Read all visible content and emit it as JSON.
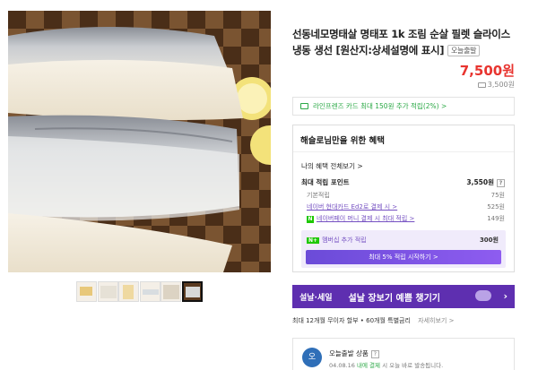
{
  "product": {
    "title": "선동네모명태살 명태포 1k 조림 순살 필렛 슬라이스 냉동 생선 [원산지:상세설명에 표시]",
    "badge": "오늘출발",
    "price": "7,500원",
    "shipping": "3,500원"
  },
  "thumbnails": [
    {
      "selected": false
    },
    {
      "selected": false
    },
    {
      "selected": false
    },
    {
      "selected": false
    },
    {
      "selected": false
    },
    {
      "selected": true
    }
  ],
  "card_promo": "라인프렌즈 카드 최대 150원 추가 적립(2%) >",
  "benefit": {
    "heading": "해슬로님만을 위한 혜택",
    "my_benefit_link": "나의 혜택 전체보기 >",
    "max_points_label": "최대 적립 포인트",
    "max_points_value": "3,550원",
    "rows": [
      {
        "label": "기본적립",
        "value": "75원"
      },
      {
        "label": "네이버 현대카드 Ed2로 결제 시 >",
        "value": "525원"
      },
      {
        "label": "네이버페이 머니 결제 시 최대 적립 >",
        "value": "149원"
      }
    ],
    "membership_label": "멤버십 추가 적립",
    "membership_value": "300원",
    "membership_button": "최대 5% 적립 시작하기 >"
  },
  "banner": {
    "left": "설날·세일",
    "text": "설날 장보기 예쁨 챙기기",
    "arrow": "›"
  },
  "installment": {
    "text": "최대 12개월 무이자 할부 • 60개월 특별금리",
    "more": "자세히보기 >"
  },
  "seller": {
    "logo_text": "오",
    "name": "오늘출발 상품",
    "date_prefix": "04.08.16",
    "date_highlight": "내에 결제",
    "date_suffix": "시 오늘 바로 발송됩니다."
  },
  "colors": {
    "price_red": "#e8342f",
    "naver_green": "#2aa845",
    "purple": "#5e2fb0"
  }
}
